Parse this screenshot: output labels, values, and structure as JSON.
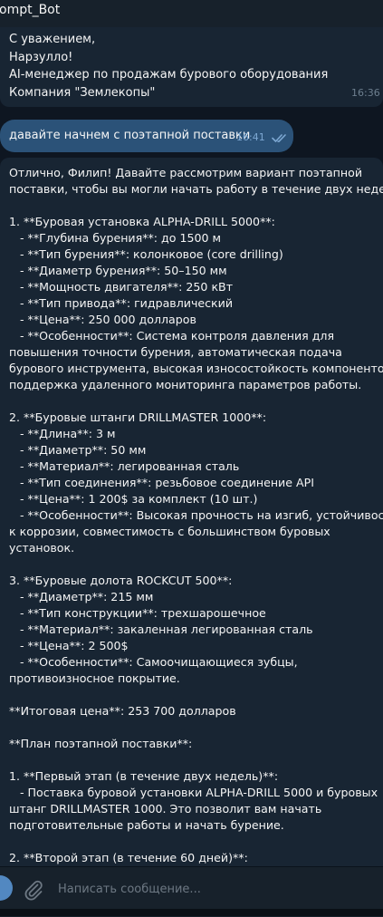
{
  "header": {
    "title": "ompt_Bot"
  },
  "previous_message": {
    "lines": [
      "С уважением,",
      "Нарзулло!",
      "AI-менеджер по продажам бурового оборудования",
      "Компания \"Землекопы\""
    ],
    "time": "16:36"
  },
  "outgoing_message": {
    "text": "давайте начнем с поэтапной поставки",
    "time": "16:41",
    "status": "read"
  },
  "incoming_message": {
    "lines": [
      "Отлично, Филип! Давайте рассмотрим вариант поэтапной",
      "поставки, чтобы вы могли начать работу в течение двух недель.",
      "",
      "1. **Буровая установка ALPHA-DRILL 5000**:",
      "   - **Глубина бурения**: до 1500 м",
      "   - **Тип бурения**: колонковое (core drilling)",
      "   - **Диаметр бурения**: 50–150 мм",
      "   - **Мощность двигателя**: 250 кВт",
      "   - **Тип привода**: гидравлический",
      "   - **Цена**: 250 000 долларов",
      "   - **Особенности**: Система контроля давления для",
      "повышения точности бурения, автоматическая подача",
      "бурового инструмента, высокая износостойкость компонентов,",
      "поддержка удаленного мониторинга параметров работы.",
      "",
      "2. **Буровые штанги DRILLMASTER 1000**:",
      "   - **Длина**: 3 м",
      "   - **Диаметр**: 50 мм",
      "   - **Материал**: легированная сталь",
      "   - **Тип соединения**: резьбовое соединение API",
      "   - **Цена**: 1 200$ за комплект (10 шт.)",
      "   - **Особенности**: Высокая прочность на изгиб, устойчивость",
      "к коррозии, совместимость с большинством буровых",
      "установок.",
      "",
      "3. **Буровые долота ROCKCUT 500**:",
      "   - **Диаметр**: 215 мм",
      "   - **Тип конструкции**: трехшарошечное",
      "   - **Материал**: закаленная легированная сталь",
      "   - **Цена**: 2 500$",
      "   - **Особенности**: Самоочищающиеся зубцы,",
      "противоизносное покрытие.",
      "",
      "**Итоговая цена**: 253 700 долларов",
      "",
      "**План поэтапной поставки**:",
      "",
      "1. **Первый этап (в течение двух недель)**:",
      "   - Поставка буровой установки ALPHA-DRILL 5000 и буровых",
      "штанг DRILLMASTER 1000. Это позволит вам начать",
      "подготовительные работы и начать бурение.",
      "",
      "2. **Второй этап (в течение 60 дней)**:"
    ]
  },
  "composer": {
    "placeholder": "Написать сообщение...",
    "value": "",
    "attach_icon": "paperclip-icon"
  }
}
